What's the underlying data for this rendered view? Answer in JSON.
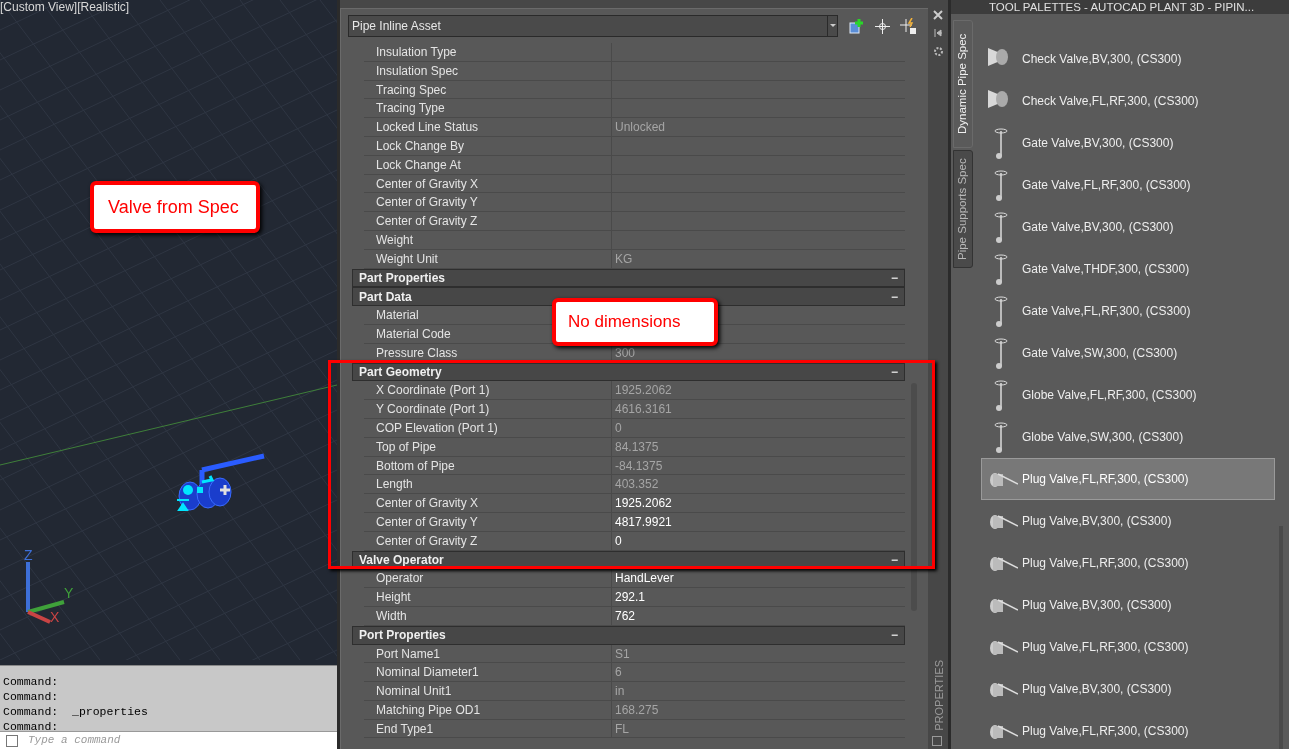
{
  "viewport": {
    "label": "[Custom View][Realistic]",
    "callout": "Valve from Spec",
    "axis_labels": [
      "Z",
      "Y",
      "X"
    ]
  },
  "command_line": {
    "history": [
      "Command:",
      "Command:",
      "Command:  _properties",
      "Command:"
    ],
    "placeholder": "Type a command"
  },
  "properties": {
    "object_type": "Pipe Inline Asset",
    "side_label": "PROPERTIES",
    "callout": "No dimensions",
    "rows": [
      {
        "kind": "property",
        "label": "Insulation Type"
      },
      {
        "kind": "property",
        "label": "Insulation Spec"
      },
      {
        "kind": "property",
        "label": "Tracing Spec"
      },
      {
        "kind": "property",
        "label": "Tracing Type"
      },
      {
        "kind": "property",
        "label": "Locked Line Status",
        "value": "Unlocked",
        "readonly": true
      },
      {
        "kind": "property",
        "label": "Lock Change By"
      },
      {
        "kind": "property",
        "label": "Lock Change At"
      },
      {
        "kind": "property",
        "label": "Center of Gravity X"
      },
      {
        "kind": "property",
        "label": "Center of Gravity Y"
      },
      {
        "kind": "property",
        "label": "Center of Gravity Z"
      },
      {
        "kind": "property",
        "label": "Weight"
      },
      {
        "kind": "property",
        "label": "Weight Unit",
        "value": "KG",
        "readonly": true
      },
      {
        "kind": "category",
        "label": "Part Properties",
        "toggle": "−",
        "expanded": true
      },
      {
        "kind": "category",
        "label": "Part Data",
        "toggle": "−",
        "expanded": true
      },
      {
        "kind": "property",
        "label": "Material"
      },
      {
        "kind": "property",
        "label": "Material Code"
      },
      {
        "kind": "property",
        "label": "Pressure Class",
        "value": "300",
        "readonly": true
      },
      {
        "kind": "category",
        "label": "Part Geometry",
        "toggle": "−",
        "expanded": true
      },
      {
        "kind": "property",
        "label": "X Coordinate (Port 1)",
        "value": "1925.2062",
        "readonly": true
      },
      {
        "kind": "property",
        "label": "Y Coordinate (Port 1)",
        "value": "4616.3161",
        "readonly": true
      },
      {
        "kind": "property",
        "label": "COP Elevation (Port 1)",
        "value": "0",
        "readonly": true
      },
      {
        "kind": "property",
        "label": "Top of Pipe",
        "value": "84.1375",
        "readonly": true
      },
      {
        "kind": "property",
        "label": "Bottom of Pipe",
        "value": "-84.1375",
        "readonly": true
      },
      {
        "kind": "property",
        "label": "Length",
        "value": "403.352",
        "readonly": true
      },
      {
        "kind": "property",
        "label": "Center of Gravity X",
        "value": "1925.2062",
        "readonly": false
      },
      {
        "kind": "property",
        "label": "Center of Gravity Y",
        "value": "4817.9921",
        "readonly": false
      },
      {
        "kind": "property",
        "label": "Center of Gravity Z",
        "value": "0",
        "readonly": false
      },
      {
        "kind": "category",
        "label": "Valve Operator",
        "toggle": "−",
        "expanded": true
      },
      {
        "kind": "property",
        "label": "Operator",
        "value": "HandLever",
        "readonly": false
      },
      {
        "kind": "property",
        "label": "Height",
        "value": "292.1",
        "readonly": false
      },
      {
        "kind": "property",
        "label": "Width",
        "value": "762",
        "readonly": false
      },
      {
        "kind": "category",
        "label": "Port Properties",
        "toggle": "−",
        "expanded": true
      },
      {
        "kind": "property",
        "label": "Port Name1",
        "value": "S1",
        "readonly": true
      },
      {
        "kind": "property",
        "label": "Nominal Diameter1",
        "value": "6",
        "readonly": true
      },
      {
        "kind": "property",
        "label": "Nominal Unit1",
        "value": "in",
        "readonly": true
      },
      {
        "kind": "property",
        "label": "Matching Pipe OD1",
        "value": "168.275",
        "readonly": true
      },
      {
        "kind": "property",
        "label": "End Type1",
        "value": "FL",
        "readonly": true
      }
    ]
  },
  "tool_palette": {
    "title": "TOOL PALETTES - AUTOCAD PLANT 3D - PIPIN...",
    "tabs": [
      {
        "label": "Dynamic Pipe Spec",
        "selected": true
      },
      {
        "label": "Pipe Supports Spec",
        "selected": false
      }
    ],
    "items": [
      {
        "label": "Check Valve,BV,300, (CS300)",
        "kind": "check",
        "selected": false
      },
      {
        "label": "Check Valve,FL,RF,300, (CS300)",
        "kind": "check",
        "selected": false
      },
      {
        "label": "Gate Valve,BV,300, (CS300)",
        "kind": "gate",
        "selected": false
      },
      {
        "label": "Gate Valve,FL,RF,300, (CS300)",
        "kind": "gate",
        "selected": false
      },
      {
        "label": "Gate Valve,BV,300, (CS300)",
        "kind": "gate",
        "selected": false
      },
      {
        "label": "Gate Valve,THDF,300, (CS300)",
        "kind": "gate",
        "selected": false
      },
      {
        "label": "Gate Valve,FL,RF,300, (CS300)",
        "kind": "gate",
        "selected": false
      },
      {
        "label": "Gate Valve,SW,300, (CS300)",
        "kind": "gate",
        "selected": false
      },
      {
        "label": "Globe Valve,FL,RF,300, (CS300)",
        "kind": "gate",
        "selected": false
      },
      {
        "label": "Globe Valve,SW,300, (CS300)",
        "kind": "gate",
        "selected": false
      },
      {
        "label": "Plug Valve,FL,RF,300, (CS300)",
        "kind": "plug",
        "selected": true
      },
      {
        "label": "Plug Valve,BV,300, (CS300)",
        "kind": "plug",
        "selected": false
      },
      {
        "label": "Plug Valve,FL,RF,300, (CS300)",
        "kind": "plug",
        "selected": false
      },
      {
        "label": "Plug Valve,BV,300, (CS300)",
        "kind": "plug",
        "selected": false
      },
      {
        "label": "Plug Valve,FL,RF,300, (CS300)",
        "kind": "plug",
        "selected": false
      },
      {
        "label": "Plug Valve,BV,300, (CS300)",
        "kind": "plug",
        "selected": false
      },
      {
        "label": "Plug Valve,FL,RF,300, (CS300)",
        "kind": "plug",
        "selected": false
      }
    ]
  }
}
